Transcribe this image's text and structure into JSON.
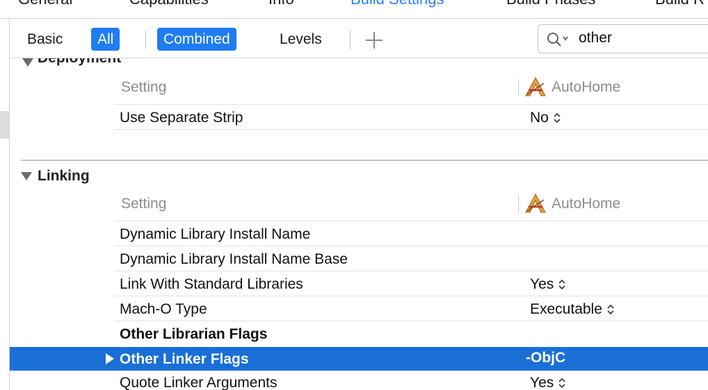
{
  "tabs": [
    {
      "label": "General",
      "active": false
    },
    {
      "label": "Capabilities",
      "active": false
    },
    {
      "label": "Info",
      "active": false
    },
    {
      "label": "Build Settings",
      "active": true
    },
    {
      "label": "Build Phases",
      "active": false
    },
    {
      "label": "Build R",
      "active": false
    }
  ],
  "filter": {
    "basic": "Basic",
    "all": "All",
    "combined": "Combined",
    "levels": "Levels",
    "search_value": "other"
  },
  "sections": {
    "deployment": {
      "title": "Deployment",
      "header_setting": "Setting",
      "header_target": "AutoHome",
      "rows": [
        {
          "name": "Use Separate Strip",
          "value": "No"
        }
      ]
    },
    "linking": {
      "title": "Linking",
      "header_setting": "Setting",
      "header_target": "AutoHome",
      "rows": [
        {
          "name": "Dynamic Library Install Name",
          "value": ""
        },
        {
          "name": "Dynamic Library Install Name Base",
          "value": ""
        },
        {
          "name": "Link With Standard Libraries",
          "value": "Yes"
        },
        {
          "name": "Mach-O Type",
          "value": "Executable"
        },
        {
          "name": "Other Librarian Flags",
          "value": ""
        },
        {
          "name": "Other Linker Flags",
          "value": "-ObjC"
        },
        {
          "name": "Quote Linker Arguments",
          "value": "Yes"
        }
      ]
    }
  },
  "colors": {
    "accent": "#1f7cf2",
    "selection": "#1a6fd6",
    "active_tab": "#2a7fff"
  }
}
